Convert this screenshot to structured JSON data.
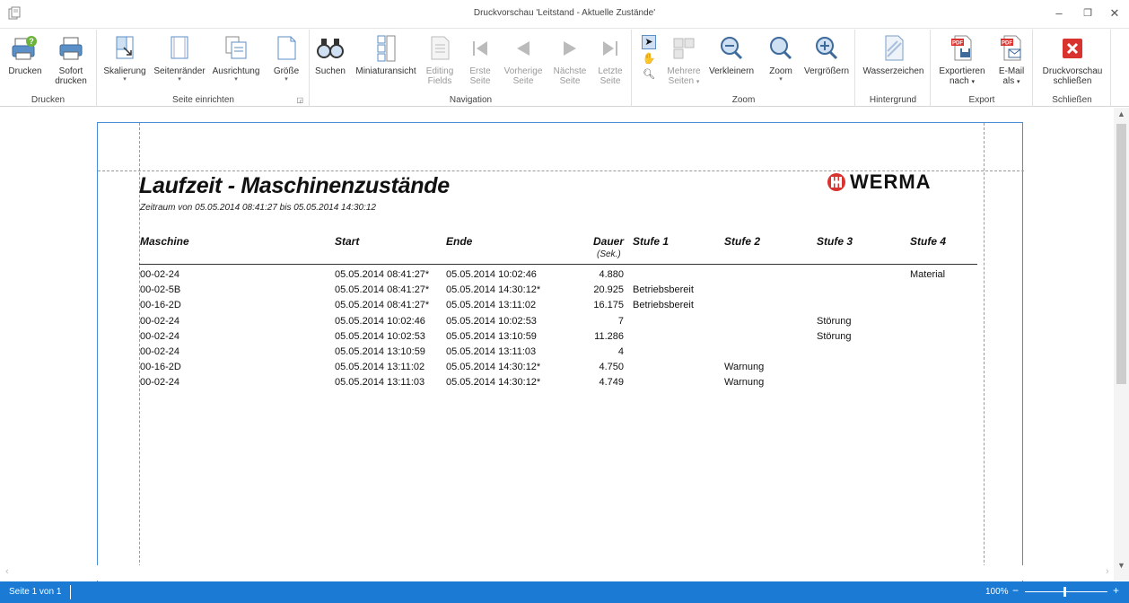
{
  "window": {
    "title": "Druckvorschau 'Leitstand - Aktuelle Zustände'",
    "minimize": "–",
    "restore": "❐",
    "close": "✕"
  },
  "ribbon": {
    "groups": {
      "drucken": "Drucken",
      "seite_einrichten": "Seite einrichten",
      "navigation": "Navigation",
      "zoom": "Zoom",
      "hintergrund": "Hintergrund",
      "export": "Export",
      "schliessen": "Schließen"
    },
    "buttons": {
      "drucken": "Drucken",
      "sofort_drucken_1": "Sofort",
      "sofort_drucken_2": "drucken",
      "skalierung": "Skalierung",
      "seitenraender": "Seitenränder",
      "ausrichtung": "Ausrichtung",
      "groesse": "Größe",
      "suchen": "Suchen",
      "miniaturansicht": "Miniaturansicht",
      "editing_1": "Editing",
      "editing_2": "Fields",
      "erste_1": "Erste",
      "erste_2": "Seite",
      "vorherige_1": "Vorherige",
      "vorherige_2": "Seite",
      "naechste_1": "Nächste",
      "naechste_2": "Seite",
      "letzte_1": "Letzte",
      "letzte_2": "Seite",
      "mehrere_1": "Mehrere",
      "mehrere_2": "Seiten",
      "verkleinern": "Verkleinern",
      "zoom": "Zoom",
      "vergroessern": "Vergrößern",
      "wasserzeichen": "Wasserzeichen",
      "exportieren_1": "Exportieren",
      "exportieren_2": "nach",
      "email_1": "E-Mail",
      "email_2": "als",
      "schliessen_1": "Druckvorschau",
      "schliessen_2": "schließen"
    },
    "colors": {
      "accent": "#1a7ad4",
      "close_red": "#d9332f"
    }
  },
  "report": {
    "title": "Laufzeit - Maschinenzustände",
    "subtitle": "Zeitraum von 05.05.2014 08:41:27 bis 05.05.2014 14:30:12",
    "logo": "WERMA",
    "columns": {
      "maschine": "Maschine",
      "start": "Start",
      "ende": "Ende",
      "dauer": "Dauer",
      "dauer_unit": "(Sek.)",
      "stufe1": "Stufe 1",
      "stufe2": "Stufe 2",
      "stufe3": "Stufe 3",
      "stufe4": "Stufe 4"
    },
    "rows": [
      {
        "maschine": "00-02-24",
        "start": "05.05.2014 08:41:27*",
        "ende": "05.05.2014 10:02:46",
        "dauer": "4.880",
        "s1": "",
        "s2": "",
        "s3": "",
        "s4": "Material"
      },
      {
        "maschine": "00-02-5B",
        "start": "05.05.2014 08:41:27*",
        "ende": "05.05.2014 14:30:12*",
        "dauer": "20.925",
        "s1": "Betriebsbereit",
        "s2": "",
        "s3": "",
        "s4": ""
      },
      {
        "maschine": "00-16-2D",
        "start": "05.05.2014 08:41:27*",
        "ende": "05.05.2014 13:11:02",
        "dauer": "16.175",
        "s1": "Betriebsbereit",
        "s2": "",
        "s3": "",
        "s4": ""
      },
      {
        "maschine": "00-02-24",
        "start": "05.05.2014 10:02:46",
        "ende": "05.05.2014 10:02:53",
        "dauer": "7",
        "s1": "",
        "s2": "",
        "s3": "Störung",
        "s4": ""
      },
      {
        "maschine": "00-02-24",
        "start": "05.05.2014 10:02:53",
        "ende": "05.05.2014 13:10:59",
        "dauer": "11.286",
        "s1": "",
        "s2": "",
        "s3": "Störung",
        "s4": ""
      },
      {
        "maschine": "00-02-24",
        "start": "05.05.2014 13:10:59",
        "ende": "05.05.2014 13:11:03",
        "dauer": "4",
        "s1": "",
        "s2": "",
        "s3": "",
        "s4": ""
      },
      {
        "maschine": "00-16-2D",
        "start": "05.05.2014 13:11:02",
        "ende": "05.05.2014 14:30:12*",
        "dauer": "4.750",
        "s1": "",
        "s2": "Warnung",
        "s3": "",
        "s4": ""
      },
      {
        "maschine": "00-02-24",
        "start": "05.05.2014 13:11:03",
        "ende": "05.05.2014 14:30:12*",
        "dauer": "4.749",
        "s1": "",
        "s2": "Warnung",
        "s3": "",
        "s4": ""
      }
    ]
  },
  "status": {
    "page": "Seite 1 von 1",
    "zoom": "100%",
    "zoom_minus": "−",
    "zoom_plus": "+"
  }
}
